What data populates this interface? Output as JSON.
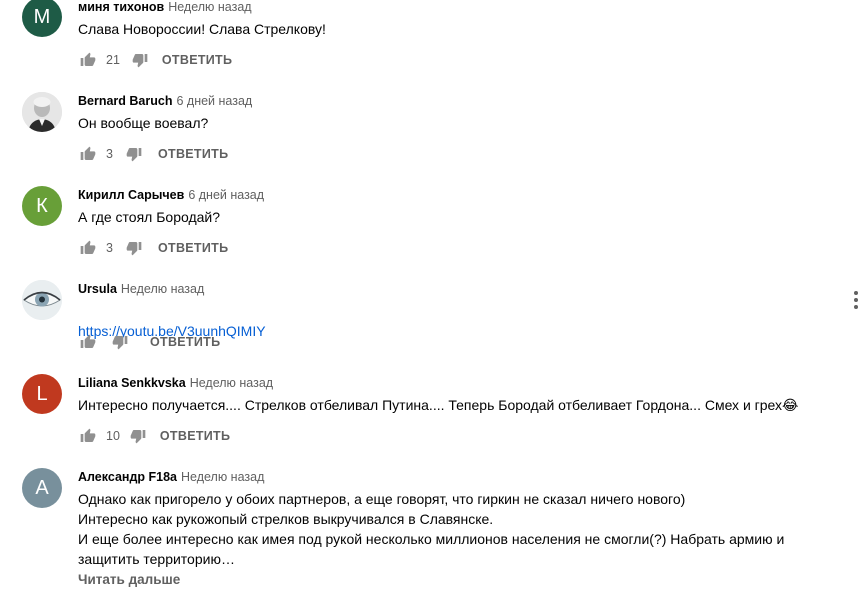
{
  "colors": {
    "link": "#065fd4",
    "meta": "#606060",
    "text": "#030303"
  },
  "comments": [
    {
      "author": "миня тихонов",
      "time": "Неделю назад",
      "text": "Слава Новороссии! Слава Стрелкову!",
      "likes": "21",
      "reply": "ОТВЕТИТЬ",
      "avatar": {
        "letter": "М",
        "color": "#1e5b46"
      }
    },
    {
      "author": "Bernard Baruch",
      "time": "6 дней назад",
      "text": "Он вообще воевал?",
      "likes": "3",
      "reply": "ОТВЕТИТЬ",
      "avatar": {
        "type": "photo-portrait"
      }
    },
    {
      "author": "Кирилл Сарычев",
      "time": "6 дней назад",
      "text": "А где стоял Бородай?",
      "likes": "3",
      "reply": "ОТВЕТИТЬ",
      "avatar": {
        "letter": "К",
        "color": "#689f38"
      }
    },
    {
      "author": "Ursula",
      "time": "Неделю назад",
      "link": "https://youtu.be/V3uunhQIMIY",
      "likes": "",
      "reply": "ОТВЕТИТЬ",
      "avatar": {
        "type": "photo-eye"
      }
    },
    {
      "author": "Liliana Senkkvska",
      "time": "Неделю назад",
      "text": "Интересно получается.... Стрелков отбеливал Путина.... Теперь Бородай отбеливает Гордона... Смех и грех",
      "emoji": "😂",
      "likes": "10",
      "reply": "ОТВЕТИТЬ",
      "avatar": {
        "letter": "L",
        "color": "#c0391f"
      }
    },
    {
      "author": "Александр F18a",
      "time": "Неделю назад",
      "text": "Однако как пригорело у обоих партнеров, а еще говорят, что гиркин не сказал ничего нового)\nИнтересно как рукожопый стрелков выкручивался в Славянске.\nИ еще более интересно как имея под рукой несколько миллионов населения не смогли(?) Набрать армию и\nзащитить территорию…",
      "read_more": "Читать дальше",
      "avatar": {
        "letter": "А",
        "color": "#78909c"
      }
    }
  ]
}
